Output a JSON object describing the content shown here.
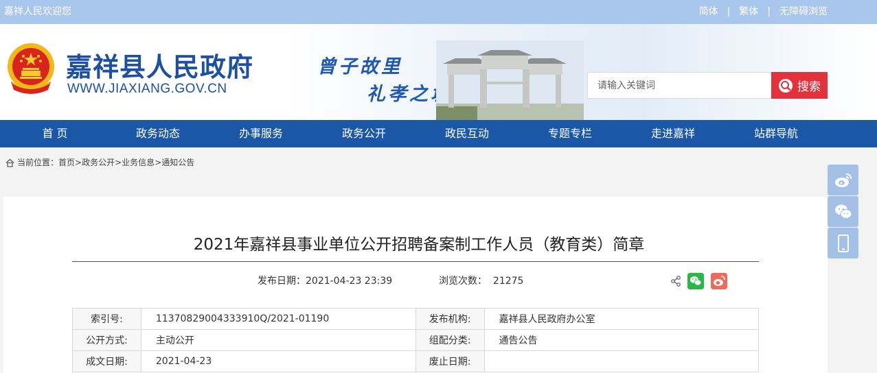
{
  "topbar": {
    "welcome": "嘉祥人民欢迎您",
    "links": [
      "简体",
      "繁体",
      "无障碍浏览"
    ],
    "separator": "|"
  },
  "header": {
    "site_title": "嘉祥县人民政府",
    "site_url": "WWW.JIAXIANG.GOV.CN",
    "slogan_line1": "曾子故里",
    "slogan_line2": "礼孝之城",
    "search": {
      "placeholder": "请输入关键词",
      "button_label": "搜索"
    }
  },
  "nav": {
    "items": [
      "首 页",
      "政务动态",
      "办事服务",
      "政务公开",
      "政民互动",
      "专题专栏",
      "走进嘉祥",
      "站群导航"
    ]
  },
  "breadcrumb": {
    "prefix": "当前位置：",
    "items": [
      "首页",
      "政务公开",
      "业务信息",
      "通知公告"
    ],
    "separator": ">"
  },
  "article": {
    "title": "2021年嘉祥县事业单位公开招聘备案制工作人员（教育类）简章",
    "publish_label": "发布日期：",
    "publish_date": "2021-04-23 23:39",
    "views_label": "浏览次数：",
    "views": "21275"
  },
  "info_table": [
    [
      "索引号:",
      "11370829004333910Q/2021-01190",
      "发布机构:",
      "嘉祥县人民政府办公室"
    ],
    [
      "公开方式:",
      "主动公开",
      "组配分类:",
      "通告公告"
    ],
    [
      "成文日期:",
      "2021-04-23",
      "废止日期:",
      ""
    ]
  ],
  "colors": {
    "topbar": "#a9c6ec",
    "brand_blue": "#1a57a7",
    "title_blue": "#1d4fa3",
    "search_red": "#e3323b",
    "wechat_green": "#27b847",
    "weibo_red": "#ee6b5a",
    "side_blue": "#a3c0e6"
  },
  "icons": [
    "national-emblem-icon",
    "search-icon",
    "home-icon",
    "share-icon",
    "wechat-icon",
    "weibo-icon",
    "mobile-icon"
  ]
}
